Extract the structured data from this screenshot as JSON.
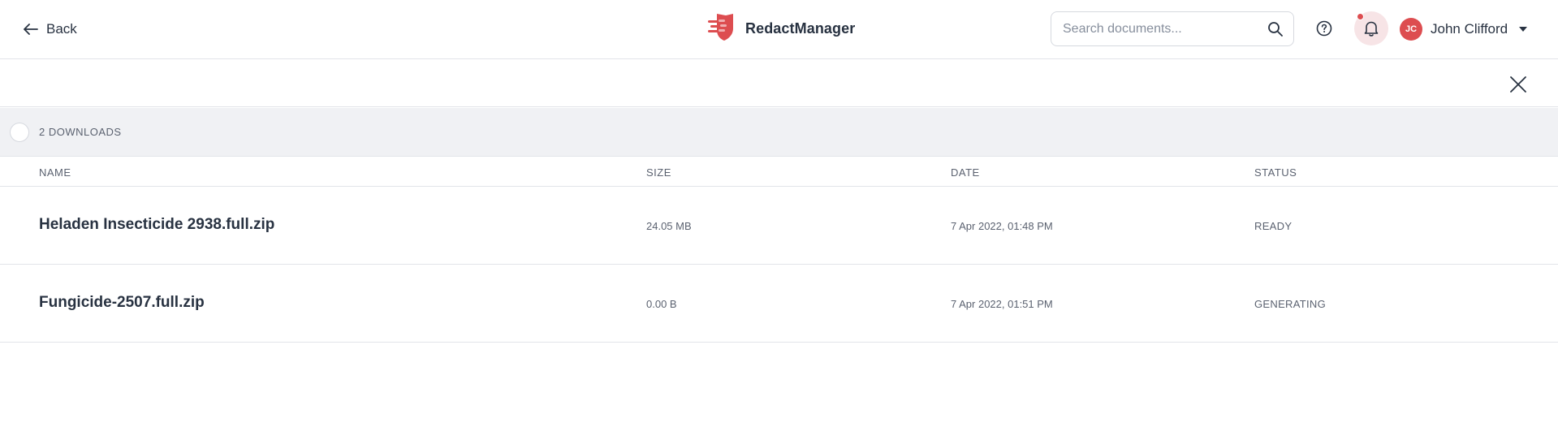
{
  "topbar": {
    "back_label": "Back",
    "brand_name": "RedactManager",
    "search_placeholder": "Search documents...",
    "user": {
      "initials": "JC",
      "name": "John Clifford"
    },
    "notifications_unread": true
  },
  "downloads": {
    "count_label": "2 DOWNLOADS",
    "columns": [
      "NAME",
      "SIZE",
      "DATE",
      "STATUS"
    ],
    "rows": [
      {
        "name": "Heladen Insecticide 2938.full.zip",
        "size": "24.05 MB",
        "date": "7 Apr 2022, 01:48 PM",
        "status": "READY"
      },
      {
        "name": "Fungicide-2507.full.zip",
        "size": "0.00 B",
        "date": "7 Apr 2022, 01:51 PM",
        "status": "GENERATING"
      }
    ]
  },
  "colors": {
    "brand": "#dd4d50",
    "text": "#283241",
    "muted": "#5b6270",
    "band": "#f0f1f4",
    "border": "#e2e4e9"
  },
  "icons": [
    "arrow-left-icon",
    "shield-logo-icon",
    "search-icon",
    "help-icon",
    "bell-icon",
    "close-icon",
    "chevron-down-icon"
  ]
}
